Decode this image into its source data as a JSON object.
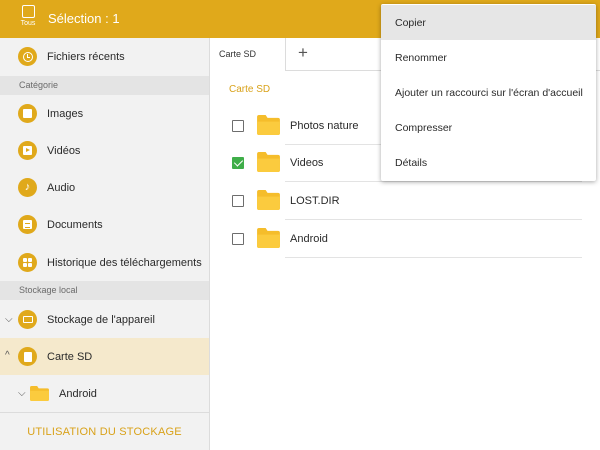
{
  "topbar": {
    "select_all_label": "Tous",
    "selection_title": "Sélection : 1",
    "accent_color": "#e0a91b"
  },
  "sidebar": {
    "recent": {
      "label": "Fichiers récents",
      "icon": "clock-icon"
    },
    "category_header": "Catégorie",
    "categories": [
      {
        "label": "Images",
        "icon": "image-icon"
      },
      {
        "label": "Vidéos",
        "icon": "video-icon"
      },
      {
        "label": "Audio",
        "icon": "music-note-icon"
      },
      {
        "label": "Documents",
        "icon": "document-icon"
      },
      {
        "label": "Historique des téléchargements",
        "icon": "apps-grid-icon"
      }
    ],
    "storage_header": "Stockage local",
    "storage": [
      {
        "label": "Stockage de l'appareil",
        "icon": "device-storage-icon",
        "expanded": true
      },
      {
        "label": "Carte SD",
        "icon": "sd-card-icon",
        "expanded": true,
        "active": true
      },
      {
        "label": "Android",
        "icon": "folder-icon",
        "expanded": true
      }
    ],
    "usage_button": "UTILISATION DU STOCKAGE"
  },
  "main": {
    "tabs": [
      {
        "label": "Carte SD"
      }
    ],
    "add_tab_symbol": "+",
    "breadcrumb": "Carte SD",
    "files": [
      {
        "name": "Photos nature",
        "checked": false
      },
      {
        "name": "Videos",
        "checked": true
      },
      {
        "name": "LOST.DIR",
        "checked": false
      },
      {
        "name": "Android",
        "checked": false
      }
    ]
  },
  "context_menu": {
    "items": [
      {
        "label": "Copier",
        "highlighted": true
      },
      {
        "label": "Renommer"
      },
      {
        "label": "Ajouter un raccourci sur l'écran d'accueil"
      },
      {
        "label": "Compresser"
      },
      {
        "label": "Détails"
      }
    ]
  }
}
